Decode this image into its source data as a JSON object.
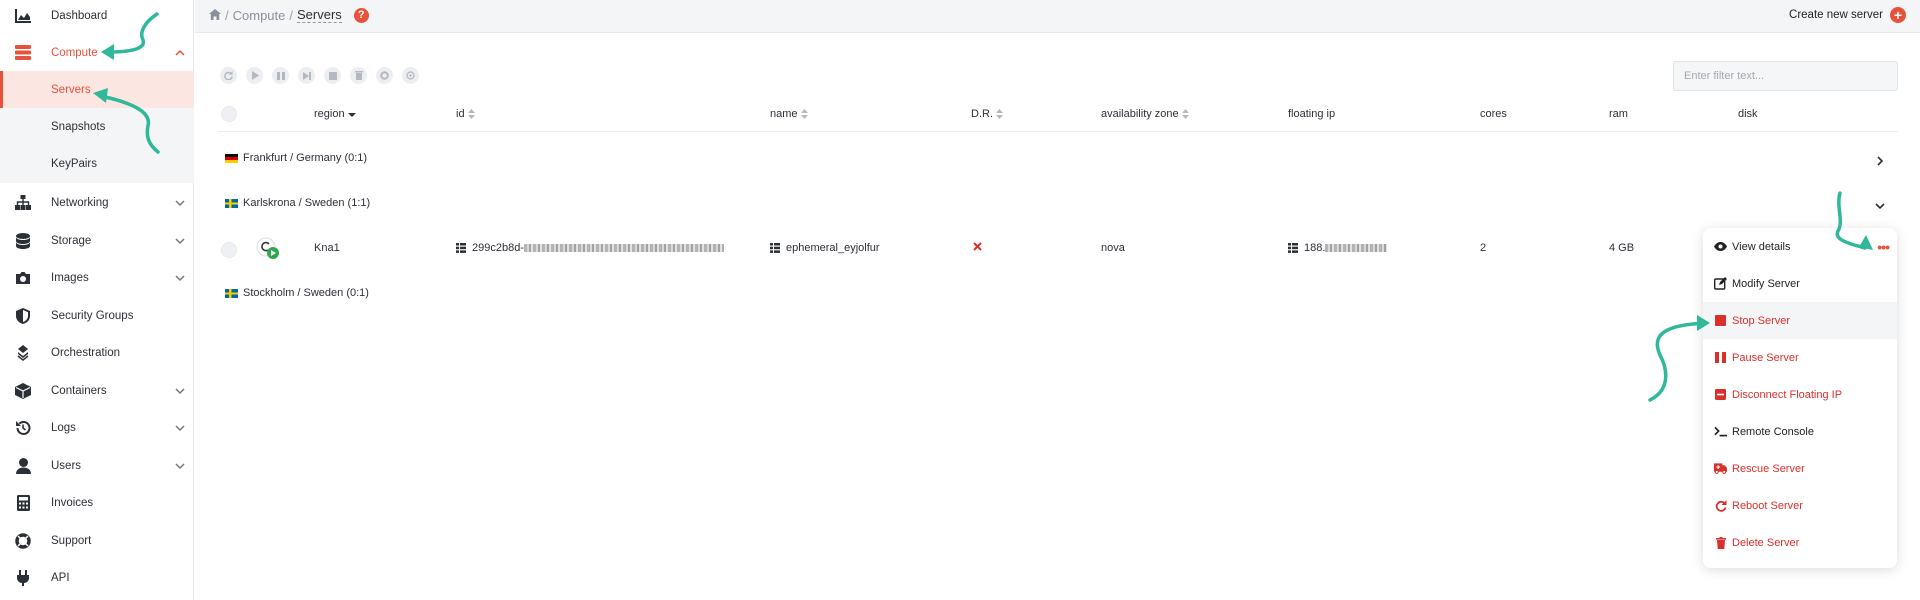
{
  "sidebar": {
    "items": [
      {
        "label": "Dashboard",
        "icon": "chart-area-icon"
      },
      {
        "label": "Compute",
        "icon": "server-icon"
      },
      {
        "label": "Networking",
        "icon": "sitemap-icon"
      },
      {
        "label": "Storage",
        "icon": "database-icon"
      },
      {
        "label": "Images",
        "icon": "camera-icon"
      },
      {
        "label": "Security Groups",
        "icon": "shield-icon"
      },
      {
        "label": "Orchestration",
        "icon": "orchestration-icon"
      },
      {
        "label": "Containers",
        "icon": "cube-icon"
      },
      {
        "label": "Logs",
        "icon": "history-icon"
      },
      {
        "label": "Users",
        "icon": "user-icon"
      },
      {
        "label": "Invoices",
        "icon": "calculator-icon"
      },
      {
        "label": "Support",
        "icon": "lifebuoy-icon"
      },
      {
        "label": "API",
        "icon": "plug-icon"
      }
    ],
    "compute_sub": [
      "Servers",
      "Snapshots",
      "KeyPairs"
    ]
  },
  "breadcrumb": {
    "home_icon": "home-icon",
    "items": [
      "Compute",
      "Servers"
    ],
    "sep": "/",
    "help": "?"
  },
  "header": {
    "create_label": "Create new server"
  },
  "filter": {
    "placeholder": "Enter filter text..."
  },
  "table": {
    "columns": [
      "region",
      "id",
      "name",
      "D.R.",
      "availability zone",
      "floating ip",
      "cores",
      "ram",
      "disk"
    ],
    "groups": [
      {
        "label": "Frankfurt / Germany (0:1)",
        "flag": "de"
      },
      {
        "label": "Karlskrona / Sweden (1:1)",
        "flag": "se"
      },
      {
        "label": "Stockholm / Sweden (0:1)",
        "flag": "se"
      }
    ],
    "server": {
      "name": "Kna1",
      "id": "299c2b8d-",
      "server_name": "ephemeral_eyjolfur",
      "zone": "nova",
      "ip": "188.",
      "cores": "2",
      "ram": "4 GB"
    }
  },
  "menu": {
    "more": "•••",
    "items": [
      {
        "label": "View details",
        "icon": "eye-icon",
        "color": "#222222"
      },
      {
        "label": "Modify Server",
        "icon": "edit-icon",
        "color": "#222222"
      },
      {
        "label": "Stop Server",
        "icon": "stop-icon",
        "color": "#d9302c"
      },
      {
        "label": "Pause Server",
        "icon": "pause-icon",
        "color": "#d9302c"
      },
      {
        "label": "Disconnect Floating IP",
        "icon": "minus-square-icon",
        "color": "#d9302c"
      },
      {
        "label": "Remote Console",
        "icon": "terminal-icon",
        "color": "#222222"
      },
      {
        "label": "Rescue Server",
        "icon": "ambulance-icon",
        "color": "#d9302c"
      },
      {
        "label": "Reboot Server",
        "icon": "redo-icon",
        "color": "#d9302c"
      },
      {
        "label": "Delete Server",
        "icon": "trash-icon",
        "color": "#d9302c"
      }
    ]
  },
  "colors": {
    "accent": "#e8513a",
    "danger": "#d9302c",
    "arrow": "#2fb89a"
  }
}
